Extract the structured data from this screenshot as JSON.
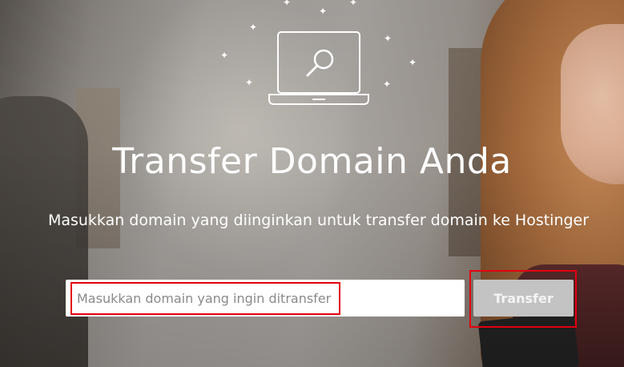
{
  "hero": {
    "title": "Transfer Domain Anda",
    "subtitle": "Masukkan domain yang diinginkan untuk transfer domain ke Hostinger",
    "illustration_icon": "laptop-search-icon",
    "sparkle_icon": "sparkle-icon"
  },
  "search": {
    "placeholder": "Masukkan domain yang ingin ditransfer",
    "value": ""
  },
  "transfer_button": {
    "label": "Transfer"
  },
  "colors": {
    "highlight_border": "#e3000f",
    "button_bg": "#c3c3c3",
    "title_text": "#ffffff"
  }
}
